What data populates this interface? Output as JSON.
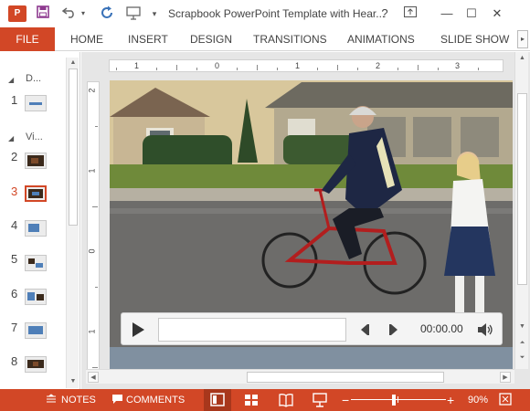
{
  "app": {
    "logo_text": "P",
    "title": "Scrapbook PowerPoint Template with Hear...",
    "help_label": "?",
    "minimize_label": "—",
    "maximize_label": "☐",
    "close_label": "✕"
  },
  "qat": {
    "save_icon": "save-icon",
    "undo_icon": "undo-icon",
    "redo_icon": "repeat-icon",
    "present_icon": "present-from-beginning-icon",
    "customize_icon": "chevron-down-icon"
  },
  "ribbon": {
    "file": "FILE",
    "tabs": [
      "HOME",
      "INSERT",
      "DESIGN",
      "TRANSITIONS",
      "ANIMATIONS",
      "SLIDE SHOW"
    ],
    "scroll_label": "▸"
  },
  "thumbnails": {
    "sections": [
      {
        "label": "D..."
      },
      {
        "label": "Vi..."
      }
    ],
    "slides": [
      {
        "number": "1"
      },
      {
        "number": "2"
      },
      {
        "number": "3",
        "selected": true
      },
      {
        "number": "4"
      },
      {
        "number": "5"
      },
      {
        "number": "6"
      },
      {
        "number": "7"
      },
      {
        "number": "8"
      }
    ]
  },
  "ruler": {
    "horizontal": [
      "1",
      "0",
      "1",
      "2",
      "3"
    ],
    "vertical": [
      "2",
      "1",
      "0",
      "1"
    ]
  },
  "player": {
    "time": "00:00.00"
  },
  "statusbar": {
    "notes": "NOTES",
    "comments": "COMMENTS",
    "zoom_out": "−",
    "zoom_in": "+",
    "zoom": "90%",
    "zoom_value": 0.9,
    "accent_color": "#d24726"
  }
}
